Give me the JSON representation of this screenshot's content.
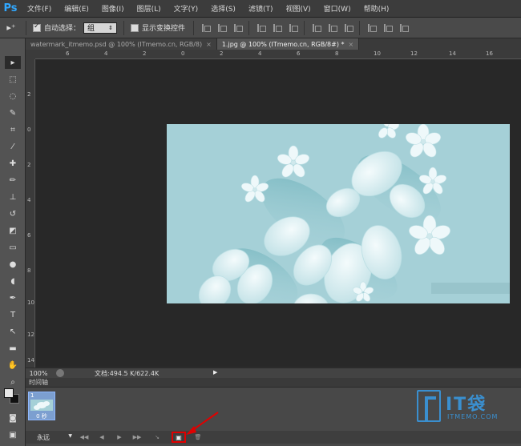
{
  "app": {
    "logo_text": "Ps"
  },
  "menu": [
    "文件(F)",
    "编辑(E)",
    "图像(I)",
    "图层(L)",
    "文字(Y)",
    "选择(S)",
    "滤镜(T)",
    "视图(V)",
    "窗口(W)",
    "帮助(H)"
  ],
  "options_bar": {
    "auto_select_label": "自动选择：",
    "auto_select_checked": true,
    "auto_select_value": "组",
    "show_transform_label": "显示变换控件",
    "show_transform_checked": false
  },
  "tabs": [
    {
      "label": "watermark_itmemo.psd @ 100% (ITmemo.cn, RGB/8)",
      "active": false
    },
    {
      "label": "1.jpg @ 100% (ITmemo.cn, RGB/8#) *",
      "active": true
    }
  ],
  "ruler": {
    "top_labels": [
      "6",
      "4",
      "2",
      "0",
      "2",
      "4",
      "6",
      "8",
      "10",
      "12",
      "14",
      "16"
    ],
    "left_labels": [
      "2",
      "0",
      "2",
      "4",
      "6",
      "8",
      "10",
      "12",
      "14"
    ]
  },
  "status": {
    "zoom": "100%",
    "doc_info": "文档:494.5 K/622.4K"
  },
  "timeline": {
    "title": "时间轴",
    "frame_number": "1",
    "frame_delay": "0 秒",
    "loop_label": "永远"
  },
  "watermark": {
    "brand": "IT袋",
    "url": "ITMEMO.COM"
  },
  "colors": {
    "accent": "#31a8ff",
    "image_bg": "#a3cfd6",
    "highlight": "#e00000"
  }
}
